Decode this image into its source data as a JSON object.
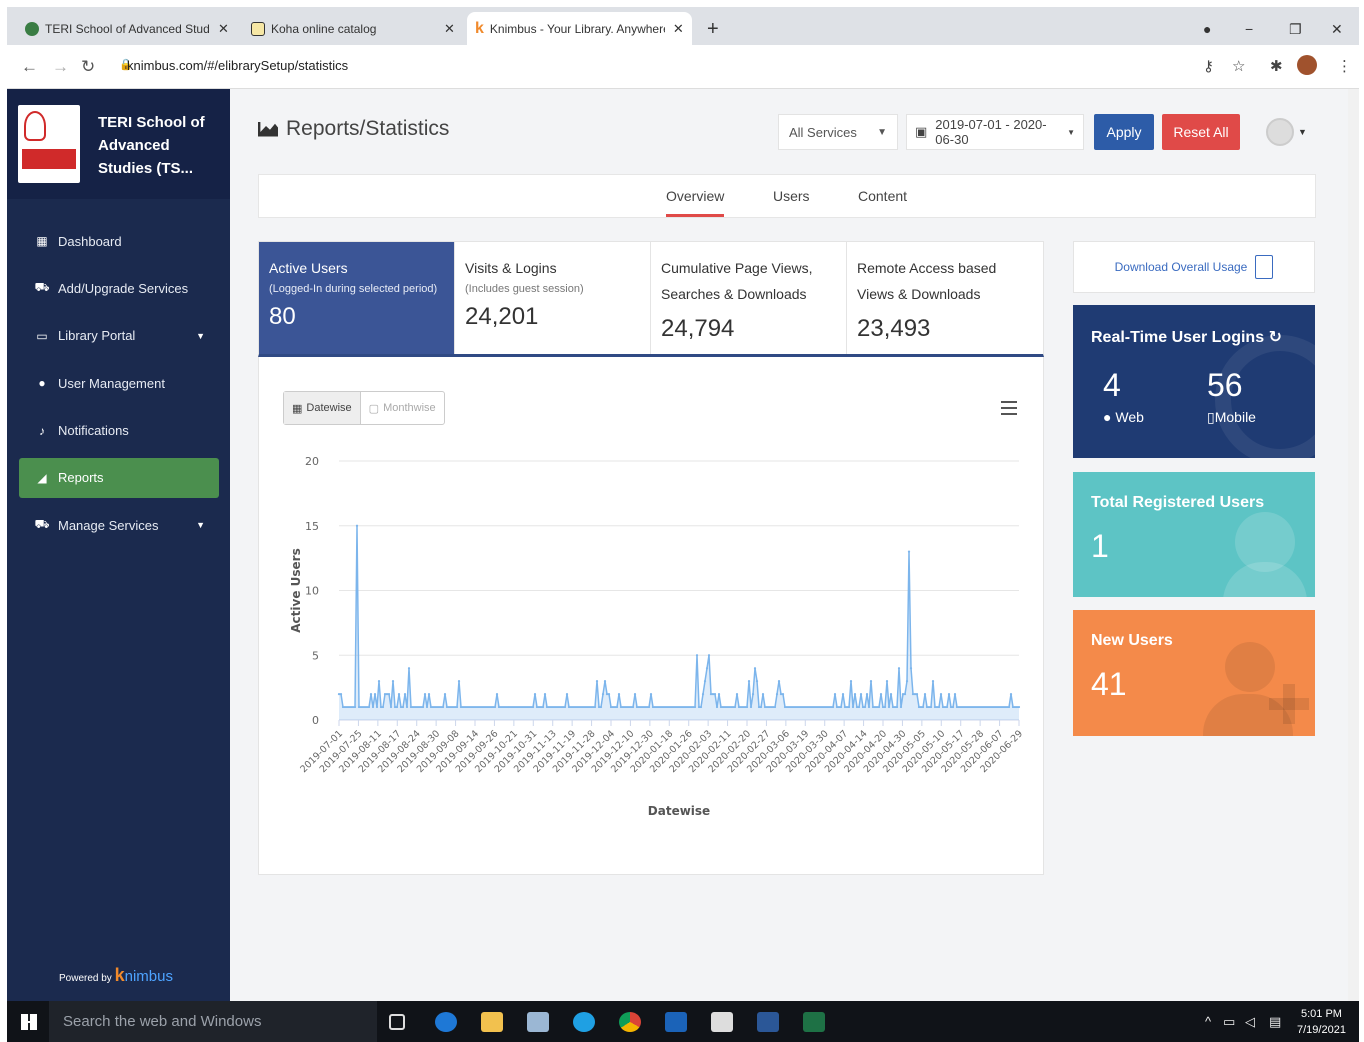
{
  "browser": {
    "tabs": [
      {
        "title": "TERI School of Advanced Studies",
        "favicon": "#3a7d44",
        "active": false
      },
      {
        "title": "Koha online catalog",
        "favicon": "#c9a227",
        "active": false
      },
      {
        "title": "Knimbus - Your Library. Anywhere",
        "favicon": "#f08a2c",
        "active": true
      }
    ],
    "url": "knimbus.com/#/elibrarySetup/statistics"
  },
  "sidebar": {
    "brand": "TERI School of Advanced Studies (TS...",
    "items": [
      {
        "label": "Dashboard",
        "icon": "dashboard-icon",
        "active": false
      },
      {
        "label": "Add/Upgrade Services",
        "icon": "cart-icon",
        "active": false
      },
      {
        "label": "Library Portal",
        "icon": "laptop-icon",
        "active": false,
        "caret": true
      },
      {
        "label": "User Management",
        "icon": "user-icon",
        "active": false
      },
      {
        "label": "Notifications",
        "icon": "bell-icon",
        "active": false
      },
      {
        "label": "Reports",
        "icon": "chart-icon",
        "active": true
      },
      {
        "label": "Manage Services",
        "icon": "cart-settings-icon",
        "active": false,
        "caret": true
      }
    ],
    "powered_label": "Powered by",
    "powered_k": "k",
    "powered_rest": "nimbus"
  },
  "header": {
    "title": "Reports/Statistics",
    "service_select": "All Services",
    "date_range": "2019-07-01 - 2020-06-30",
    "apply": "Apply",
    "reset": "Reset All"
  },
  "tabs": [
    "Overview",
    "Users",
    "Content"
  ],
  "stats": [
    {
      "label": "Active Users",
      "sub": "(Logged-In during selected period)",
      "value": "80",
      "active": true
    },
    {
      "label": "Visits & Logins",
      "sub": "(Includes guest session)",
      "value": "24,201",
      "active": false
    },
    {
      "label": "Cumulative Page Views, Searches & Downloads",
      "sub": "",
      "value": "24,794",
      "active": false
    },
    {
      "label": "Remote Access based Views & Downloads",
      "sub": "",
      "value": "23,493",
      "active": false
    }
  ],
  "chart_toggle": {
    "datewise": "Datewise",
    "monthwise": "Monthwise"
  },
  "right": {
    "download": "Download Overall Usage",
    "realtime_title": "Real-Time User Logins",
    "web_value": "4",
    "web_label": "Web",
    "mobile_value": "56",
    "mobile_label": "Mobile",
    "registered_title": "Total Registered Users",
    "registered_value": "1",
    "new_title": "New Users",
    "new_value": "41"
  },
  "chart_data": {
    "type": "area",
    "xlabel": "Datewise",
    "ylabel": "Active Users",
    "ylim": [
      0,
      20
    ],
    "yticks": [
      0,
      5,
      10,
      15,
      20
    ],
    "grid": true,
    "color": "#7cb5ec",
    "x_ticks": [
      "2019-07-01",
      "2019-07-25",
      "2019-08-11",
      "2019-08-17",
      "2019-08-24",
      "2019-08-30",
      "2019-09-08",
      "2019-09-14",
      "2019-09-26",
      "2019-10-21",
      "2019-10-31",
      "2019-11-13",
      "2019-11-19",
      "2019-11-28",
      "2019-12-04",
      "2019-12-10",
      "2019-12-30",
      "2020-01-18",
      "2020-01-26",
      "2020-02-03",
      "2020-02-11",
      "2020-02-20",
      "2020-02-27",
      "2020-03-06",
      "2020-03-19",
      "2020-03-30",
      "2020-04-07",
      "2020-04-14",
      "2020-04-20",
      "2020-04-30",
      "2020-05-05",
      "2020-05-10",
      "2020-05-17",
      "2020-05-28",
      "2020-06-07",
      "2020-06-29"
    ],
    "values": [
      2,
      2,
      1,
      1,
      1,
      1,
      1,
      1,
      1,
      15,
      1,
      1,
      1,
      1,
      1,
      1,
      2,
      1,
      2,
      1,
      3,
      1,
      1,
      2,
      2,
      2,
      1,
      3,
      1,
      1,
      2,
      1,
      1,
      2,
      1,
      4,
      1,
      1,
      1,
      1,
      1,
      1,
      1,
      2,
      1,
      2,
      1,
      1,
      1,
      1,
      1,
      1,
      1,
      2,
      1,
      1,
      1,
      1,
      1,
      1,
      3,
      1,
      1,
      1,
      1,
      1,
      1,
      1,
      1,
      1,
      1,
      1,
      1,
      1,
      1,
      1,
      1,
      1,
      1,
      2,
      1,
      1,
      1,
      1,
      1,
      1,
      1,
      1,
      1,
      1,
      1,
      1,
      1,
      1,
      1,
      1,
      1,
      1,
      2,
      1,
      1,
      1,
      1,
      2,
      1,
      1,
      1,
      1,
      1,
      1,
      1,
      1,
      1,
      1,
      2,
      1,
      1,
      1,
      1,
      1,
      1,
      1,
      1,
      1,
      1,
      1,
      1,
      1,
      1,
      3,
      1,
      1,
      2,
      3,
      2,
      2,
      1,
      1,
      1,
      1,
      2,
      1,
      1,
      1,
      1,
      1,
      1,
      1,
      2,
      1,
      1,
      1,
      1,
      1,
      1,
      1,
      2,
      1,
      1,
      1,
      1,
      1,
      1,
      1,
      1,
      1,
      1,
      1,
      1,
      1,
      1,
      1,
      1,
      1,
      1,
      1,
      1,
      1,
      1,
      5,
      1,
      1,
      2,
      3,
      4,
      5,
      2,
      2,
      2,
      1,
      2,
      1,
      1,
      1,
      1,
      1,
      1,
      1,
      1,
      2,
      1,
      1,
      1,
      1,
      1,
      3,
      1,
      2,
      4,
      3,
      1,
      1,
      2,
      1,
      1,
      1,
      1,
      1,
      1,
      2,
      3,
      2,
      2,
      1,
      1,
      1,
      1,
      1,
      1,
      1,
      1,
      1,
      1,
      1,
      1,
      1,
      1,
      1,
      1,
      1,
      1,
      1,
      1,
      1,
      1,
      1,
      1,
      1,
      2,
      1,
      1,
      1,
      2,
      1,
      1,
      1,
      3,
      1,
      2,
      1,
      1,
      2,
      1,
      1,
      2,
      1,
      3,
      1,
      1,
      1,
      1,
      2,
      1,
      1,
      3,
      1,
      2,
      1,
      1,
      1,
      4,
      1,
      2,
      2,
      3,
      13,
      4,
      2,
      2,
      2,
      1,
      1,
      1,
      2,
      1,
      1,
      1,
      3,
      1,
      1,
      1,
      2,
      1,
      1,
      1,
      2,
      1,
      1,
      2,
      1,
      1,
      1,
      1,
      1,
      1,
      1,
      1,
      1,
      1,
      1,
      1,
      1,
      1,
      1,
      1,
      1,
      1,
      1,
      1,
      1,
      1,
      1,
      1,
      1,
      1,
      1,
      2,
      1,
      1,
      1,
      1
    ]
  },
  "taskbar": {
    "search": "Search the web and Windows",
    "time": "5:01 PM",
    "date": "7/19/2021"
  }
}
